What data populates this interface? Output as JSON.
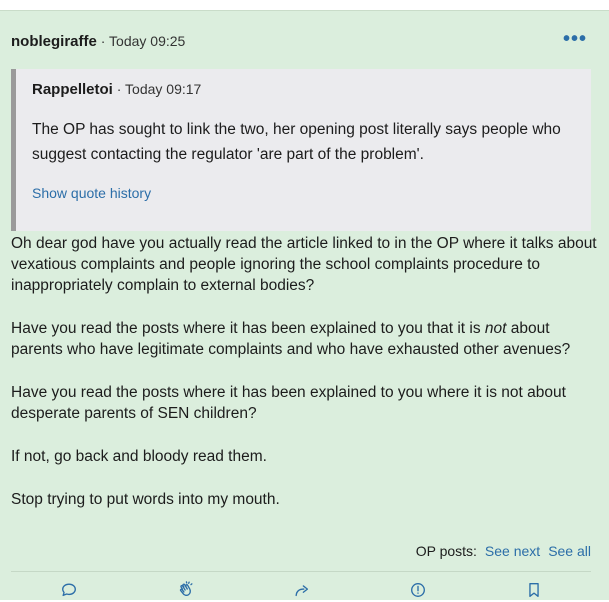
{
  "post": {
    "username": "noblegiraffe",
    "timestamp": " · Today 09:25",
    "more_label": "•••",
    "quote": {
      "username": "Rappelletoi",
      "timestamp": " · Today 09:17",
      "text": "The OP has sought to link the two, her opening post literally says people who suggest contacting the regulator 'are part of the problem'.",
      "history_link": "Show quote history"
    },
    "paragraphs": {
      "p1": "Oh dear god have you actually read the article linked to in the OP where it talks about vexatious complaints and people ignoring the school complaints procedure to inappropriately complain to external bodies?",
      "p2_before": "Have you read the posts where it has been explained to you that it is ",
      "p2_emphasis": "not",
      "p2_after": " about parents who have legitimate complaints and who have exhausted other avenues?",
      "p3": "Have you read the posts where it has been explained to you where it is not about desperate parents of SEN children?",
      "p4": "If not, go back and bloody read them.",
      "p5": "Stop trying to put words into my mouth."
    },
    "op_posts": {
      "label": "OP posts:",
      "see_next": "See next",
      "see_all": "See all"
    },
    "actions": {
      "icons": [
        "reply-icon",
        "clap-icon",
        "share-icon",
        "report-icon",
        "bookmark-icon"
      ]
    }
  },
  "colors": {
    "post_background": "#dbeedd",
    "quote_background": "#ebebee",
    "link": "#2c6ea8"
  }
}
